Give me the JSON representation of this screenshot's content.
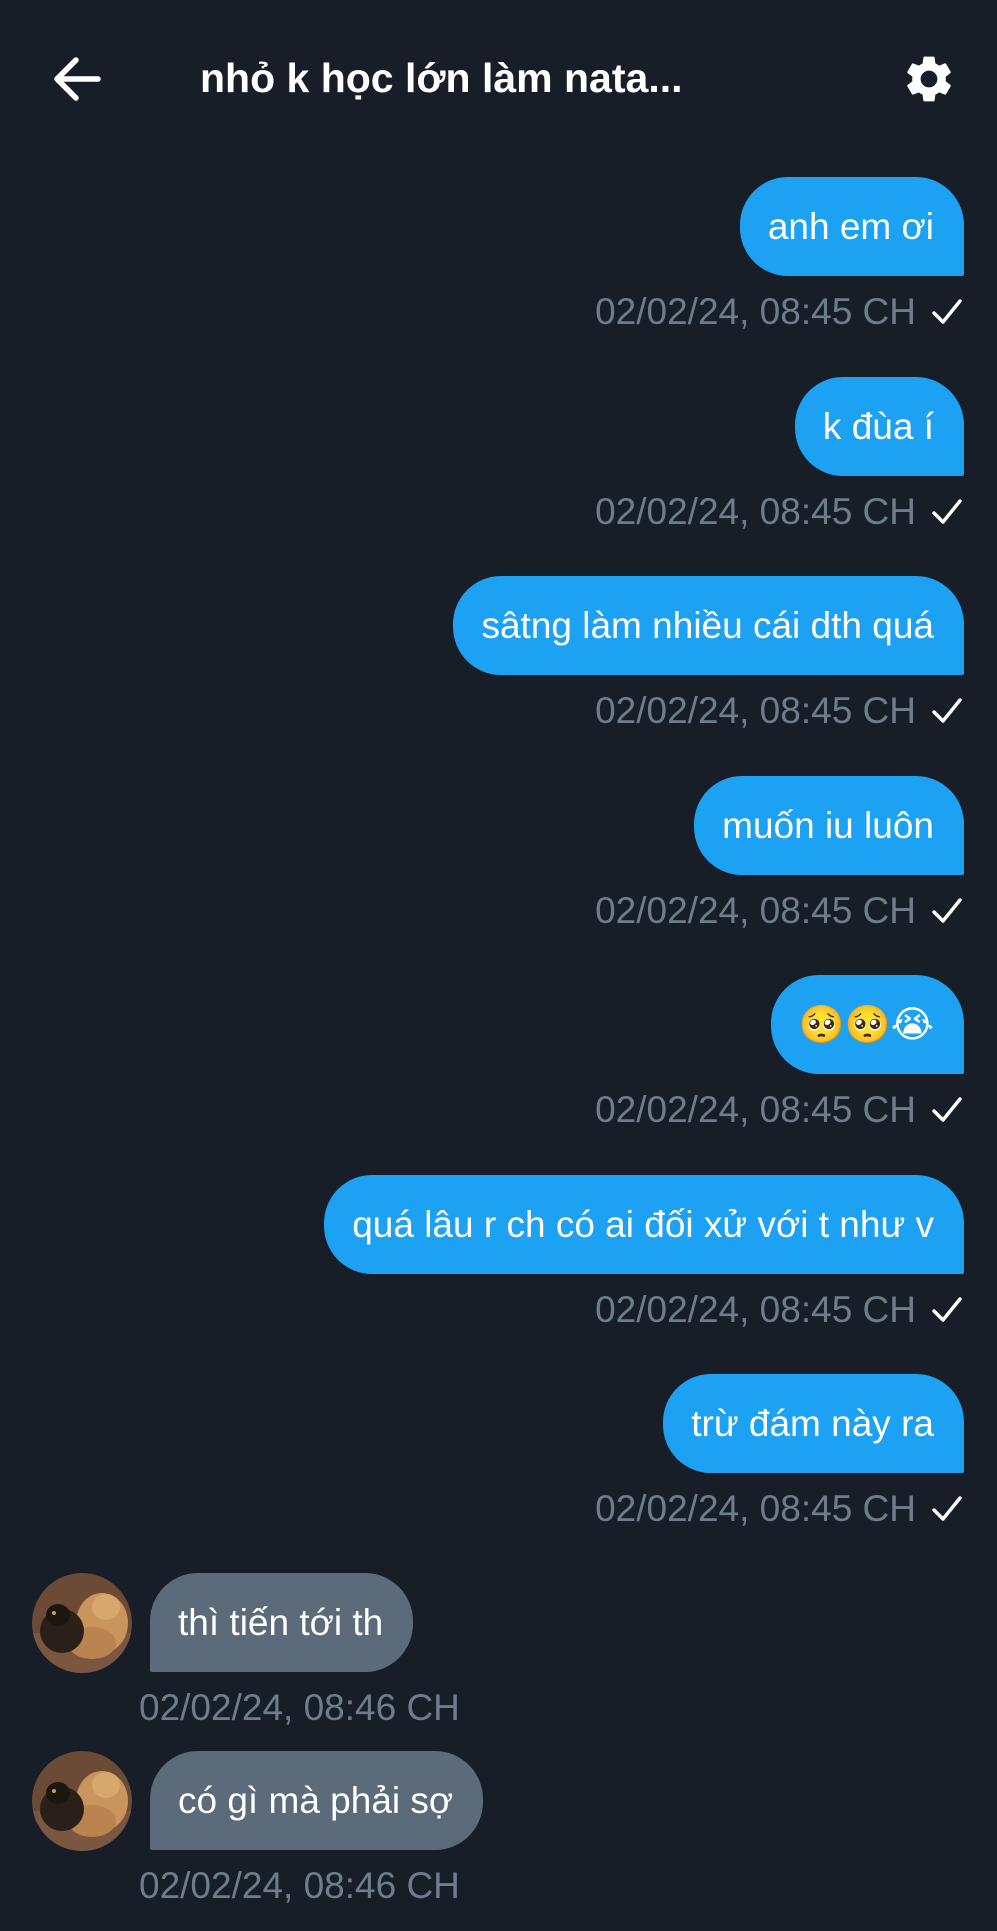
{
  "header": {
    "title": "nhỏ k học lớn làm nata...",
    "back_icon": "arrow-left-icon",
    "settings_icon": "gear-icon"
  },
  "colors": {
    "background": "#171e28",
    "outgoing_bubble": "#1da1f2",
    "incoming_bubble": "#5c6b7a",
    "timestamp": "#6e7d8c"
  },
  "messages": [
    {
      "direction": "outgoing",
      "text": "anh em ơi",
      "time": "02/02/24, 08:45 CH",
      "status_icon": "checkmark-icon"
    },
    {
      "direction": "outgoing",
      "text": "k đùa í",
      "time": "02/02/24, 08:45 CH",
      "status_icon": "checkmark-icon"
    },
    {
      "direction": "outgoing",
      "text": "sâtng làm nhiều cái dth quá",
      "time": "02/02/24, 08:45 CH",
      "status_icon": "checkmark-icon"
    },
    {
      "direction": "outgoing",
      "text": "muốn iu luôn",
      "time": "02/02/24, 08:45 CH",
      "status_icon": "checkmark-icon"
    },
    {
      "direction": "outgoing",
      "text": "🥺🥺😭",
      "time": "02/02/24, 08:45 CH",
      "status_icon": "checkmark-icon"
    },
    {
      "direction": "outgoing",
      "text": "quá lâu r ch có ai đối xử với t như v",
      "time": "02/02/24, 08:45 CH",
      "status_icon": "checkmark-icon"
    },
    {
      "direction": "outgoing",
      "text": "trừ đám này ra",
      "time": "02/02/24, 08:45 CH",
      "status_icon": "checkmark-icon"
    },
    {
      "direction": "incoming",
      "text": "thì tiến tới th",
      "time": "02/02/24, 08:46 CH",
      "avatar_icon": "avatar-dogs-image"
    },
    {
      "direction": "incoming",
      "text": "có gì mà phải sợ",
      "time": "02/02/24, 08:46 CH",
      "avatar_icon": "avatar-dogs-image"
    }
  ]
}
